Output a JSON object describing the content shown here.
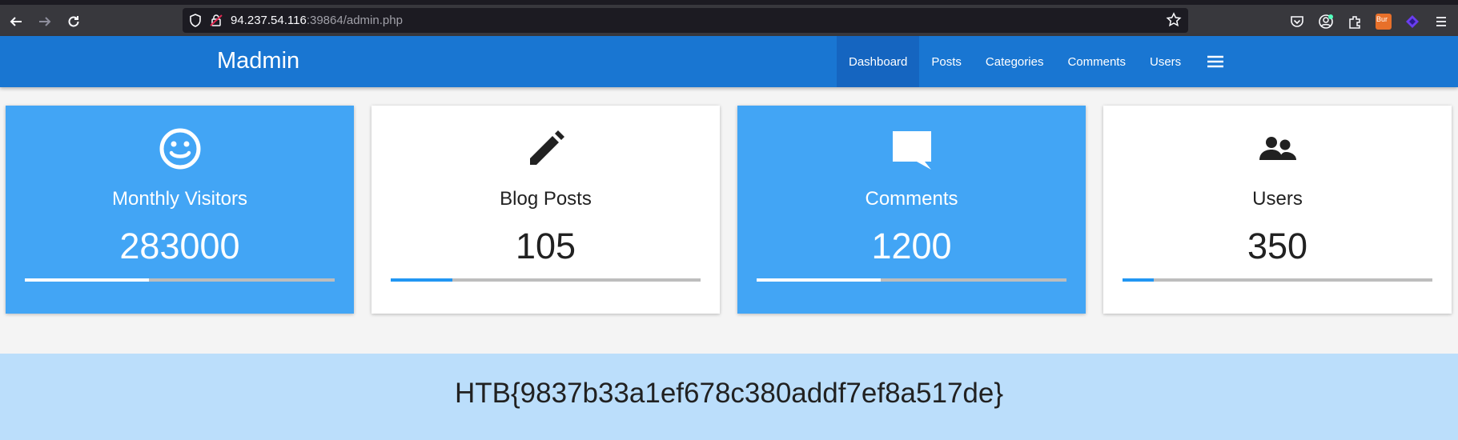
{
  "browser": {
    "url_host": "94.237.54.116",
    "url_rest": ":39864/admin.php",
    "extension_badge": "Bur"
  },
  "header": {
    "brand": "Madmin",
    "nav": [
      {
        "label": "Dashboard",
        "active": true
      },
      {
        "label": "Posts"
      },
      {
        "label": "Categories"
      },
      {
        "label": "Comments"
      },
      {
        "label": "Users"
      }
    ]
  },
  "cards": [
    {
      "label": "Monthly Visitors",
      "value": "283000",
      "icon": "smiley-icon",
      "style": "blue",
      "progress": 0.4
    },
    {
      "label": "Blog Posts",
      "value": "105",
      "icon": "pencil-icon",
      "style": "white",
      "progress": 0.2
    },
    {
      "label": "Comments",
      "value": "1200",
      "icon": "comment-icon",
      "style": "blue",
      "progress": 0.4
    },
    {
      "label": "Users",
      "value": "350",
      "icon": "users-icon",
      "style": "white",
      "progress": 0.1
    }
  ],
  "flag": "HTB{9837b33a1ef678c380addf7ef8a517de}",
  "colors": {
    "header": "#1976d2",
    "card_blue": "#42a5f5",
    "banner": "#bbdefb"
  }
}
